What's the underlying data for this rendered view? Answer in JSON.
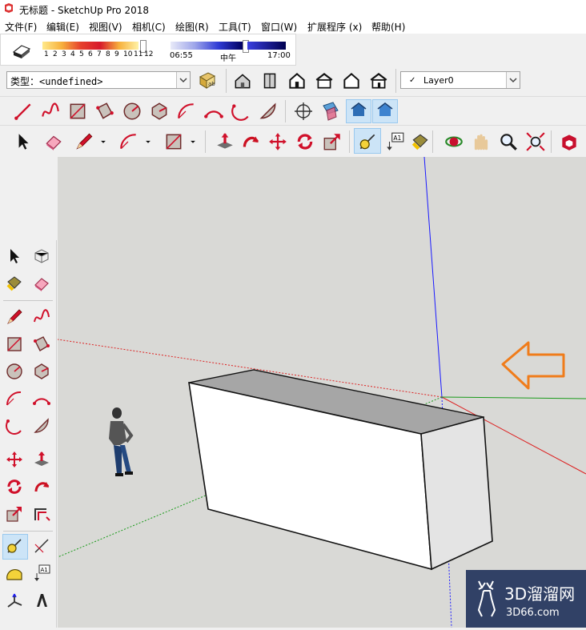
{
  "window": {
    "title": "无标题 - SketchUp Pro 2018"
  },
  "menu": [
    "文件(F)",
    "编辑(E)",
    "视图(V)",
    "相机(C)",
    "绘图(R)",
    "工具(T)",
    "窗口(W)",
    "扩展程序 (x)",
    "帮助(H)"
  ],
  "shadow": {
    "month_ticks": [
      "1",
      "2",
      "3",
      "4",
      "5",
      "6",
      "7",
      "8",
      "9",
      "10",
      "11",
      "12"
    ],
    "time_start": "06:55",
    "time_mid": "中午",
    "time_end": "17:00"
  },
  "entity_info": {
    "label": "类型：",
    "value": "<undefined>"
  },
  "layer": {
    "check": "✓",
    "name": "Layer0"
  },
  "colors": {
    "accent_orange": "#f07c1a",
    "axis_blue": "#1a1aff",
    "axis_red": "#d22",
    "axis_green": "#1a9a1a",
    "selected_bg": "#cce4f7"
  },
  "icons": {
    "views": [
      "iso-house-icon",
      "top-view-icon",
      "front-view-icon",
      "right-view-icon",
      "back-view-icon",
      "left-view-icon"
    ],
    "draw_row": [
      "line-icon",
      "freehand-icon",
      "rectangle-icon",
      "rotated-rectangle-icon",
      "circle-icon",
      "polygon-icon",
      "arc-icon",
      "2pt-arc-icon",
      "3pt-arc-icon",
      "pie-icon"
    ],
    "main_row": [
      "select-icon",
      "eraser-icon",
      "pencil-icon",
      "arc-dropdown-icon",
      "rectangle-dropdown-icon",
      "push-pull-icon",
      "follow-me-icon",
      "move-icon",
      "rotate-icon",
      "scale-icon",
      "tape-measure-icon",
      "text-icon",
      "paint-bucket-icon",
      "orbit-icon",
      "pan-icon",
      "zoom-icon",
      "zoom-extents-icon",
      "3d-warehouse-icon"
    ]
  },
  "watermark": {
    "text": "3D溜溜网",
    "url": "3D66.com"
  },
  "leftbar_text": {
    "label": "A1"
  }
}
